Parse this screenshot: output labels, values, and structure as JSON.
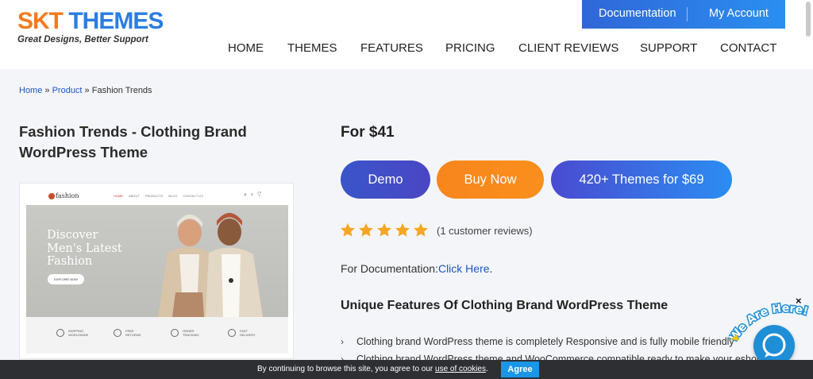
{
  "header": {
    "logo": {
      "main_part1": "SKT",
      "main_part2": " THEMES",
      "tagline": "Great Designs, Better Support"
    },
    "top_buttons": {
      "documentation": "Documentation",
      "my_account": "My Account"
    },
    "nav": [
      "HOME",
      "THEMES",
      "FEATURES",
      "PRICING",
      "CLIENT REVIEWS",
      "SUPPORT",
      "CONTACT"
    ]
  },
  "breadcrumb": {
    "home": "Home",
    "sep1": " » ",
    "product": "Product",
    "sep2": " » ",
    "current": "Fashion Trends"
  },
  "product": {
    "title": "Fashion Trends - Clothing Brand WordPress Theme",
    "price": "For $41",
    "buttons": {
      "demo": "Demo",
      "buy": "Buy Now",
      "bundle": "420+ Themes for $69"
    },
    "rating": {
      "stars": 5,
      "reviews_text": "(1 customer reviews)"
    },
    "doc_label": "For Documentation:",
    "doc_link": "Click Here",
    "doc_suffix": ".",
    "features_heading": "Unique Features Of Clothing Brand WordPress Theme",
    "features": [
      "Clothing brand WordPress theme is completely Responsive and is fully mobile friendly",
      "Clothing brand WordPress theme and WooCommerce compatible ready to make your eshop"
    ]
  },
  "preview": {
    "logo": "fashion",
    "menu": [
      "HOME",
      "ABOUT",
      "PRODUCTS",
      "BLOG",
      "CONTACT US"
    ],
    "headline_lines": [
      "Discover",
      "Men's Latest",
      "Fashion"
    ],
    "explore_btn": "EXPLORE NOW",
    "features": [
      "SHIPPING WORLDWIDE",
      "FREE RETURNS",
      "ORDER TRACKING",
      "FAST DELIVERY"
    ]
  },
  "cookie": {
    "msg_prefix": "By continuing to browse this site, you agree to our ",
    "msg_link": "use of cookies",
    "msg_suffix": ".",
    "agree": "Agree"
  },
  "chat": {
    "tag": "We Are Here!",
    "close": "×"
  },
  "colors": {
    "brand_orange": "#f37a1f",
    "brand_blue": "#2a7de1",
    "link": "#1a56c5",
    "star": "#f5a623",
    "cookie_bg": "#2d2f33"
  }
}
